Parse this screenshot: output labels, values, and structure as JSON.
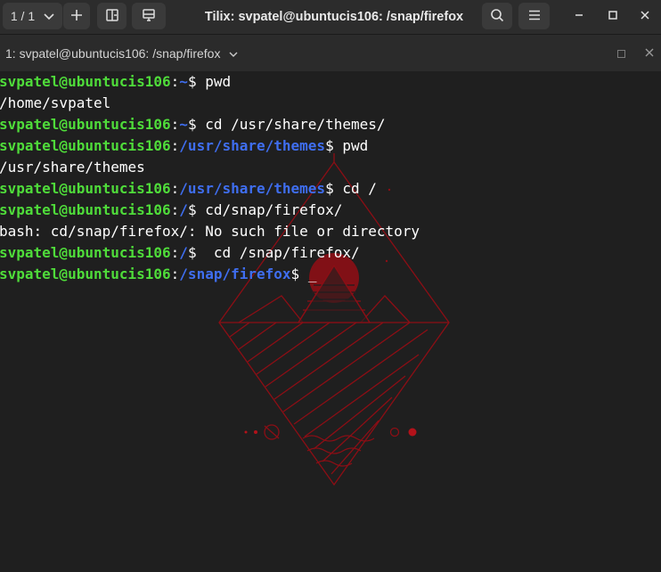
{
  "window": {
    "title": "Tilix: svpatel@ubuntucis106: /snap/firefox"
  },
  "header": {
    "session_label": "1 / 1",
    "session_chevron": "chevron-down-icon",
    "add_icon": "plus-icon",
    "split_right_icon": "split-right-icon",
    "split_down_icon": "split-down-icon",
    "search_icon": "search-icon",
    "menu_icon": "hamburger-menu-icon"
  },
  "terminal_bar": {
    "title": "1: svpatel@ubuntucis106: /snap/firefox",
    "chevron": "chevron-down-icon"
  },
  "colors": {
    "user_host": "#4fdc3a",
    "path": "#3f6ef0",
    "wallpaper_accent": "#9b0f16",
    "background": "#1f1f1f"
  },
  "terminal": {
    "lines": [
      {
        "type": "prompt",
        "user": "svpatel@ubuntucis106",
        "sep": ":",
        "path": "~",
        "sym": "$",
        "cmd": " pwd"
      },
      {
        "type": "output",
        "text": "/home/svpatel"
      },
      {
        "type": "prompt",
        "user": "svpatel@ubuntucis106",
        "sep": ":",
        "path": "~",
        "sym": "$",
        "cmd": " cd /usr/share/themes/"
      },
      {
        "type": "prompt",
        "user": "svpatel@ubuntucis106",
        "sep": ":",
        "path": "/usr/share/themes",
        "sym": "$",
        "cmd": " pwd"
      },
      {
        "type": "output",
        "text": "/usr/share/themes"
      },
      {
        "type": "prompt",
        "user": "svpatel@ubuntucis106",
        "sep": ":",
        "path": "/usr/share/themes",
        "sym": "$",
        "cmd": " cd /"
      },
      {
        "type": "prompt",
        "user": "svpatel@ubuntucis106",
        "sep": ":",
        "path": "/",
        "sym": "$",
        "cmd": " cd/snap/firefox/"
      },
      {
        "type": "output",
        "text": "bash: cd/snap/firefox/: No such file or directory"
      },
      {
        "type": "prompt",
        "user": "svpatel@ubuntucis106",
        "sep": ":",
        "path": "/",
        "sym": "$",
        "cmd": "  cd /snap/firefox/"
      },
      {
        "type": "prompt",
        "user": "svpatel@ubuntucis106",
        "sep": ":",
        "path": "/snap/firefox",
        "sym": "$",
        "cmd": " ",
        "cursor": "_"
      }
    ]
  }
}
